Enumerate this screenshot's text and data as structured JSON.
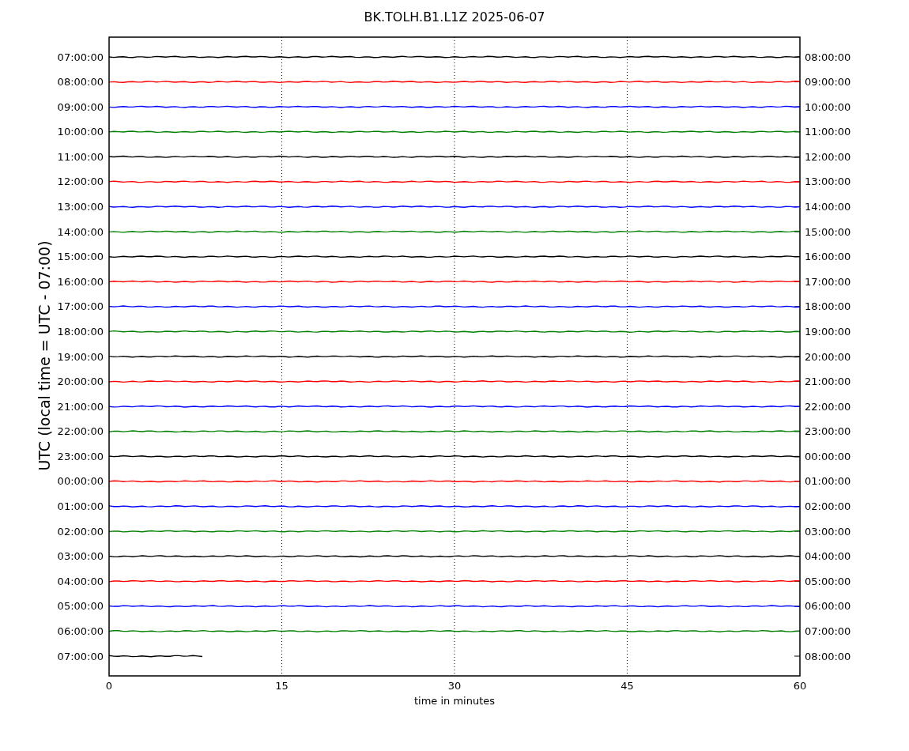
{
  "title": "BK.TOLH.B1.L1Z 2025-06-07",
  "ylabel": "UTC (local time = UTC - 07:00)",
  "xlabel": "time in minutes",
  "xticks": [
    "0",
    "15",
    "30",
    "45",
    "60"
  ],
  "traces": [
    {
      "left": "07:00:00",
      "right": "08:00:00",
      "color": "#000000",
      "level": 1
    },
    {
      "left": "08:00:00",
      "right": "09:00:00",
      "color": "#ff0000",
      "level": 1
    },
    {
      "left": "09:00:00",
      "right": "10:00:00",
      "color": "#0000ff",
      "level": 1
    },
    {
      "left": "10:00:00",
      "right": "11:00:00",
      "color": "#008000",
      "level": 1
    },
    {
      "left": "11:00:00",
      "right": "12:00:00",
      "color": "#000000",
      "level": 1
    },
    {
      "left": "12:00:00",
      "right": "13:00:00",
      "color": "#ff0000",
      "level": 1
    },
    {
      "left": "13:00:00",
      "right": "14:00:00",
      "color": "#0000ff",
      "level": 1
    },
    {
      "left": "14:00:00",
      "right": "15:00:00",
      "color": "#008000",
      "level": 1
    },
    {
      "left": "15:00:00",
      "right": "16:00:00",
      "color": "#000000",
      "level": 1
    },
    {
      "left": "16:00:00",
      "right": "17:00:00",
      "color": "#ff0000",
      "level": 1
    },
    {
      "left": "17:00:00",
      "right": "18:00:00",
      "color": "#0000ff",
      "level": 1
    },
    {
      "left": "18:00:00",
      "right": "19:00:00",
      "color": "#008000",
      "level": 1
    },
    {
      "left": "19:00:00",
      "right": "20:00:00",
      "color": "#000000",
      "level": 1
    },
    {
      "left": "20:00:00",
      "right": "21:00:00",
      "color": "#ff0000",
      "level": 1
    },
    {
      "left": "21:00:00",
      "right": "22:00:00",
      "color": "#0000ff",
      "level": 1
    },
    {
      "left": "22:00:00",
      "right": "23:00:00",
      "color": "#008000",
      "level": 1
    },
    {
      "left": "23:00:00",
      "right": "00:00:00",
      "color": "#000000",
      "level": 1
    },
    {
      "left": "00:00:00",
      "right": "01:00:00",
      "color": "#ff0000",
      "level": 1
    },
    {
      "left": "01:00:00",
      "right": "02:00:00",
      "color": "#0000ff",
      "level": 1
    },
    {
      "left": "02:00:00",
      "right": "03:00:00",
      "color": "#008000",
      "level": 1
    },
    {
      "left": "03:00:00",
      "right": "04:00:00",
      "color": "#000000",
      "level": 1
    },
    {
      "left": "04:00:00",
      "right": "05:00:00",
      "color": "#ff0000",
      "level": 1
    },
    {
      "left": "05:00:00",
      "right": "06:00:00",
      "color": "#0000ff",
      "level": 1
    },
    {
      "left": "06:00:00",
      "right": "07:00:00",
      "color": "#008000",
      "level": 1
    },
    {
      "left": "07:00:00",
      "right": "08:00:00",
      "color": "#000000",
      "level": 0.135
    }
  ]
}
